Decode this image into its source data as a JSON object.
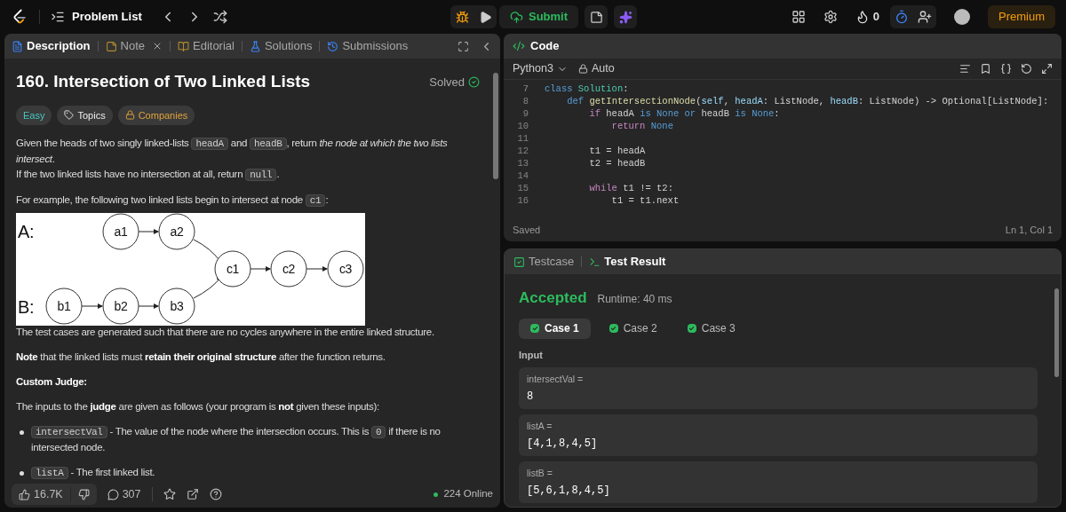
{
  "nav": {
    "title": "Problem List",
    "submit": "Submit",
    "streak": "0",
    "premium": "Premium"
  },
  "description_tabs": [
    {
      "label": "Description",
      "kind": "description",
      "selected": true
    },
    {
      "label": "Note",
      "kind": "note",
      "selected": false
    },
    {
      "label": "Editorial",
      "kind": "editorial",
      "selected": false
    },
    {
      "label": "Solutions",
      "kind": "solutions",
      "selected": false
    },
    {
      "label": "Submissions",
      "kind": "submissions",
      "selected": false
    }
  ],
  "problem": {
    "title": "160. Intersection of Two Linked Lists",
    "status": "Solved",
    "tags": [
      {
        "label": "Easy",
        "kind": "difficulty"
      },
      {
        "label": "Topics",
        "kind": "topics"
      },
      {
        "label": "Companies",
        "kind": "companies"
      }
    ],
    "blocks": [
      {
        "kind": "para",
        "lines": [
          [
            {
              "kind": "text",
              "text": "Given the heads of two singly linked-lists "
            },
            {
              "kind": "code",
              "text": "headA"
            },
            {
              "kind": "text",
              "text": " and "
            },
            {
              "kind": "code",
              "text": "headB"
            },
            {
              "kind": "text",
              "text": ", return "
            },
            {
              "kind": "italic",
              "text": "the node at which the two lists intersect"
            },
            {
              "kind": "text",
              "text": "."
            }
          ],
          [
            {
              "kind": "text",
              "text": "If the two linked lists have no intersection at all, return "
            },
            {
              "kind": "code",
              "text": "null"
            },
            {
              "kind": "text",
              "text": "."
            }
          ]
        ]
      },
      {
        "kind": "para",
        "lines": [
          [
            {
              "kind": "text",
              "text": "For example, the following two linked lists begin to intersect at node "
            },
            {
              "kind": "code",
              "text": "c1"
            },
            {
              "kind": "text",
              "text": ":"
            }
          ]
        ]
      },
      {
        "kind": "diagram",
        "labels": [
          "A:",
          "B:"
        ],
        "nodes": [
          "a1",
          "a2",
          "b1",
          "b2",
          "b3",
          "c1",
          "c2",
          "c3"
        ]
      },
      {
        "kind": "para",
        "lines": [
          [
            {
              "kind": "text",
              "text": "The test cases are generated such that there are no cycles anywhere in the entire linked structure."
            }
          ]
        ]
      },
      {
        "kind": "para",
        "lines": [
          [
            {
              "kind": "bold",
              "text": "Note"
            },
            {
              "kind": "text",
              "text": " that the linked lists must "
            },
            {
              "kind": "bold",
              "text": "retain their original structure"
            },
            {
              "kind": "text",
              "text": " after the function returns."
            }
          ]
        ]
      },
      {
        "kind": "para",
        "lines": [
          [
            {
              "kind": "bold",
              "text": "Custom Judge:"
            }
          ]
        ]
      },
      {
        "kind": "para",
        "lines": [
          [
            {
              "kind": "text",
              "text": "The inputs to the "
            },
            {
              "kind": "bold",
              "text": "judge"
            },
            {
              "kind": "text",
              "text": " are given as follows (your program is "
            },
            {
              "kind": "bold",
              "text": "not"
            },
            {
              "kind": "text",
              "text": " given these inputs):"
            }
          ]
        ]
      },
      {
        "kind": "bullet",
        "lines": [
          [
            {
              "kind": "code",
              "text": "intersectVal"
            },
            {
              "kind": "text",
              "text": " - The value of the node where the intersection occurs. This is "
            },
            {
              "kind": "code",
              "text": "0"
            },
            {
              "kind": "text",
              "text": " if there is no intersected node."
            }
          ]
        ]
      },
      {
        "kind": "bullet",
        "lines": [
          [
            {
              "kind": "code",
              "text": "listA"
            },
            {
              "kind": "text",
              "text": " - The first linked list."
            }
          ]
        ]
      }
    ]
  },
  "footer": {
    "likes": "16.7K",
    "comments": "307",
    "online": "224 Online"
  },
  "editor": {
    "title": "Code",
    "language": "Python3",
    "mode": "Auto",
    "status": "Saved",
    "cursor": "Ln 1, Col 1",
    "lines": [
      {
        "number": "7",
        "tokens": [
          {
            "kind": "keyword",
            "text": "class "
          },
          {
            "kind": "type",
            "text": "Solution"
          },
          {
            "kind": "plain",
            "text": ":"
          }
        ]
      },
      {
        "number": "8",
        "tokens": [
          {
            "kind": "keyword",
            "text": "    def "
          },
          {
            "kind": "function",
            "text": "getIntersectionNode"
          },
          {
            "kind": "plain",
            "text": "("
          },
          {
            "kind": "param",
            "text": "self"
          },
          {
            "kind": "plain",
            "text": ", "
          },
          {
            "kind": "param",
            "text": "headA"
          },
          {
            "kind": "plain",
            "text": ": ListNode, "
          },
          {
            "kind": "param",
            "text": "headB"
          },
          {
            "kind": "plain",
            "text": ": ListNode) -> Optional[ListNode]:"
          }
        ]
      },
      {
        "number": "9",
        "tokens": [
          {
            "kind": "control",
            "text": "        if"
          },
          {
            "kind": "plain",
            "text": " headA "
          },
          {
            "kind": "keyword",
            "text": "is None or"
          },
          {
            "kind": "plain",
            "text": " headB "
          },
          {
            "kind": "keyword",
            "text": "is None"
          },
          {
            "kind": "plain",
            "text": ":"
          }
        ]
      },
      {
        "number": "10",
        "tokens": [
          {
            "kind": "control",
            "text": "            return"
          },
          {
            "kind": "keyword",
            "text": " None"
          }
        ]
      },
      {
        "number": "11"
      },
      {
        "number": "12",
        "tokens": [
          {
            "kind": "plain",
            "text": "        t1 = headA"
          }
        ]
      },
      {
        "number": "13",
        "tokens": [
          {
            "kind": "plain",
            "text": "        t2 = headB"
          }
        ]
      },
      {
        "number": "14"
      },
      {
        "number": "15",
        "tokens": [
          {
            "kind": "control",
            "text": "        while"
          },
          {
            "kind": "plain",
            "text": " t1 != t2:"
          }
        ]
      },
      {
        "number": "16",
        "tokens": [
          {
            "kind": "plain",
            "text": "            t1 = t1.next"
          }
        ]
      }
    ]
  },
  "results": {
    "tabs": [
      {
        "label": "Testcase",
        "kind": "testcase",
        "selected": false
      },
      {
        "label": "Test Result",
        "kind": "result",
        "selected": true
      }
    ],
    "verdict": "Accepted",
    "runtime": "Runtime: 40 ms",
    "cases": [
      {
        "label": "Case 1",
        "selected": true,
        "passed": true
      },
      {
        "label": "Case 2",
        "selected": false,
        "passed": true
      },
      {
        "label": "Case 3",
        "selected": false,
        "passed": true
      }
    ],
    "input_label": "Input",
    "inputs": [
      {
        "name": "intersectVal =",
        "value": "8"
      },
      {
        "name": "listA =",
        "value": "[4,1,8,4,5]"
      },
      {
        "name": "listB =",
        "value": "[5,6,1,8,4,5]"
      }
    ]
  }
}
